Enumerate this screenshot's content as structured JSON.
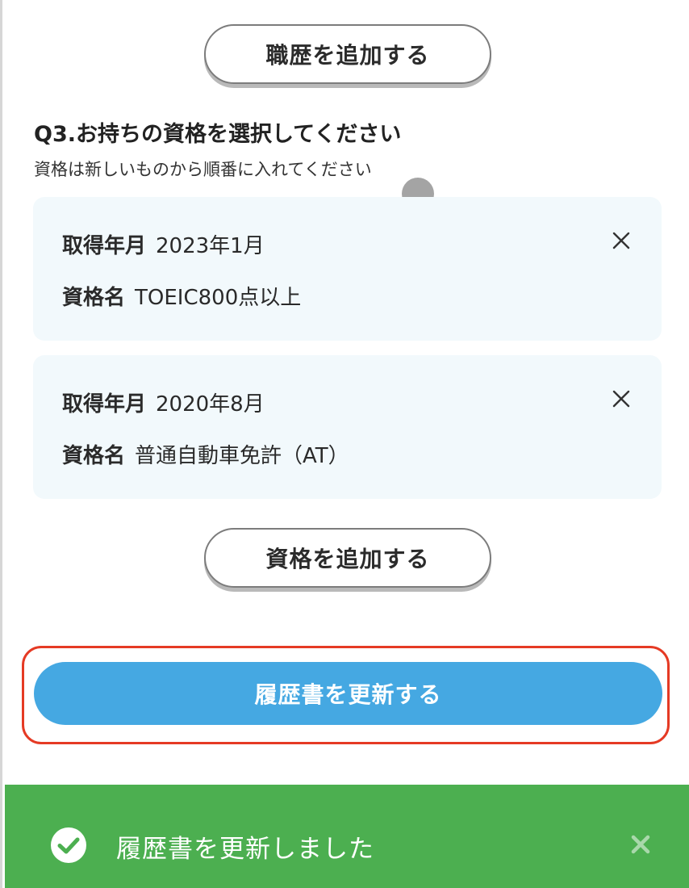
{
  "career": {
    "add_button_label": "職歴を追加する"
  },
  "question": {
    "title": "Q3.お持ちの資格を選択してください",
    "subtitle": "資格は新しいものから順番に入れてください"
  },
  "licenses": [
    {
      "date_label": "取得年月",
      "date_value": "2023年1月",
      "name_label": "資格名",
      "name_value": "TOEIC800点以上",
      "remove_icon": "close-icon"
    },
    {
      "date_label": "取得年月",
      "date_value": "2020年8月",
      "name_label": "資格名",
      "name_value": "普通自動車免許（AT）",
      "remove_icon": "close-icon"
    }
  ],
  "license_actions": {
    "add_button_label": "資格を追加する"
  },
  "submit": {
    "label": "履歴書を更新する",
    "color": "#45a8e2",
    "highlight_color": "#e53a24"
  },
  "toast": {
    "message": "履歴書を更新しました",
    "icon": "check-circle-icon",
    "close_icon": "close-icon",
    "background": "#4caf50"
  }
}
